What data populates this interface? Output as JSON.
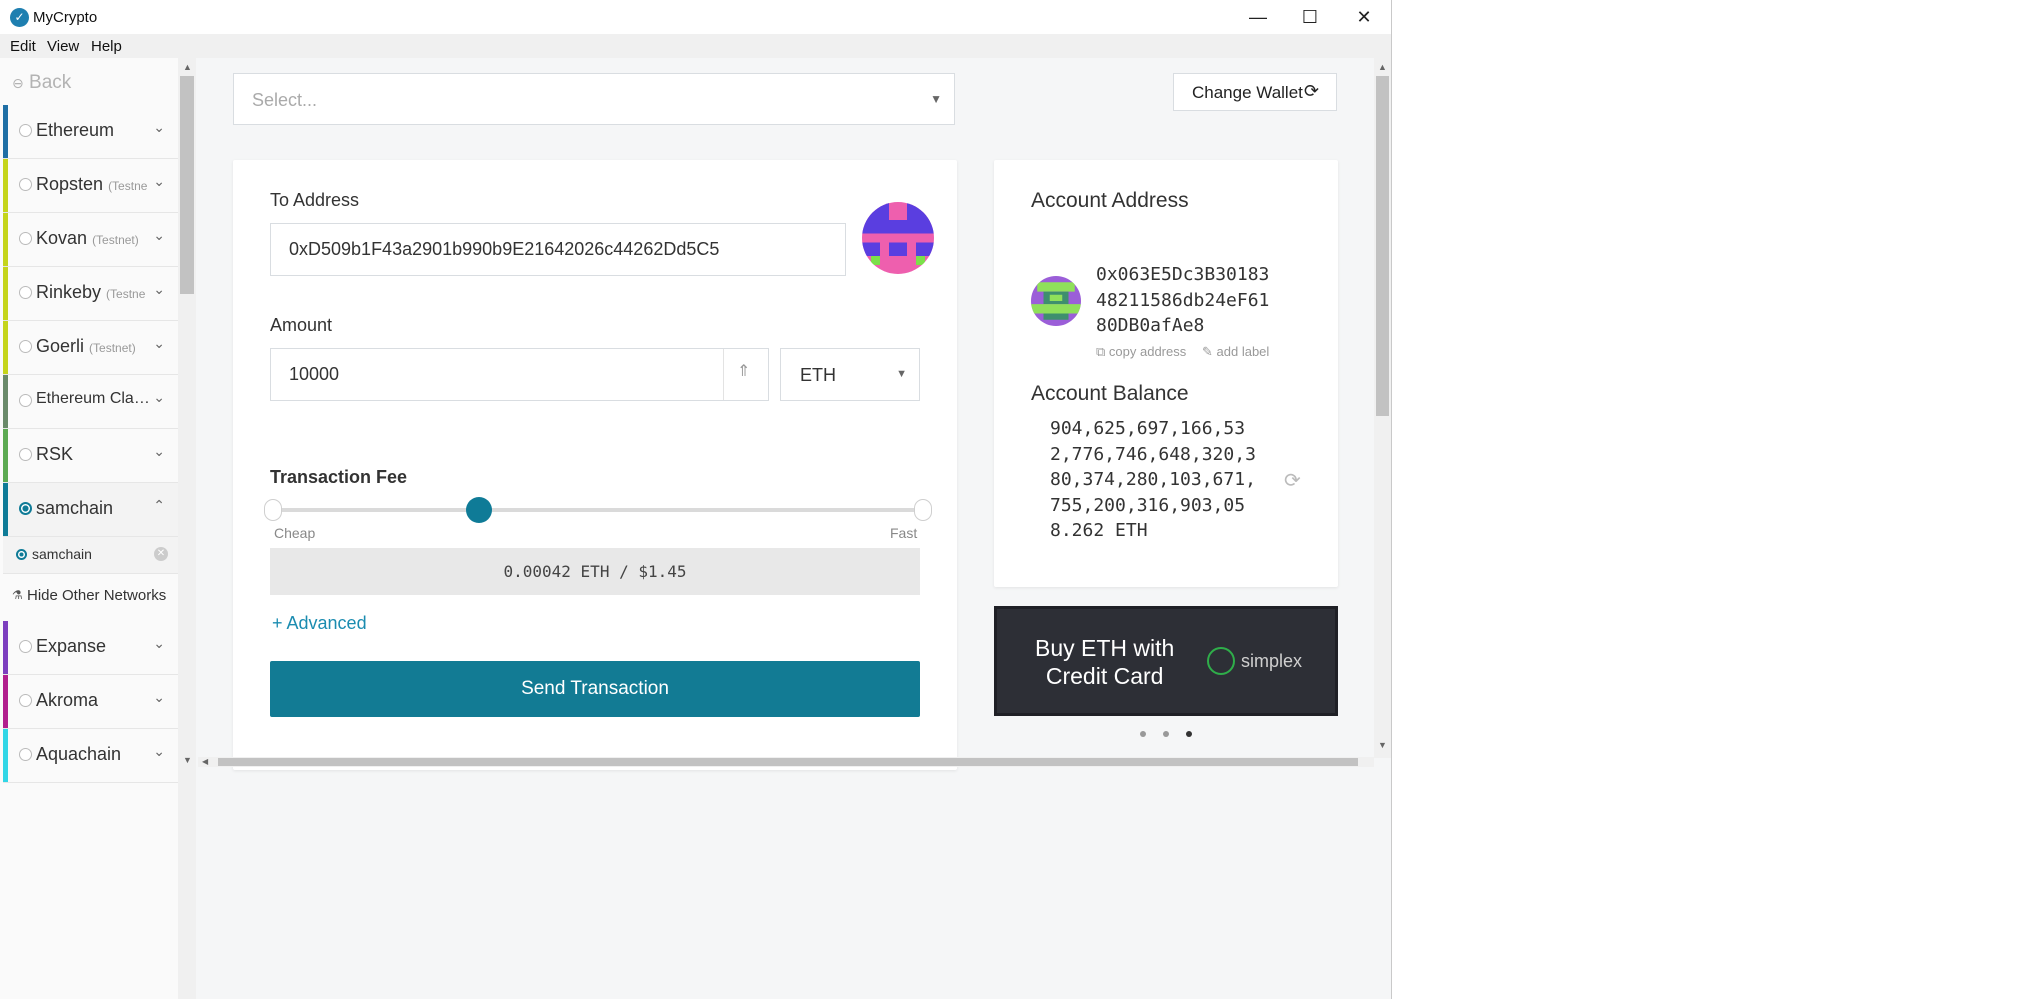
{
  "window": {
    "title": "MyCrypto",
    "minimize": "—",
    "maximize": "☐",
    "close": "✕"
  },
  "menu": [
    "Edit",
    "View",
    "Help"
  ],
  "sidebar": {
    "back_label": "Back",
    "networks": [
      {
        "name": "Ethereum",
        "testnet": "",
        "color": "#1f6fa5"
      },
      {
        "name": "Ropsten",
        "testnet": "(Testne",
        "color": "#c5d51b"
      },
      {
        "name": "Kovan",
        "testnet": "(Testnet)",
        "color": "#c5d51b"
      },
      {
        "name": "Rinkeby",
        "testnet": "(Testne",
        "color": "#c5d51b"
      },
      {
        "name": "Goerli",
        "testnet": "(Testnet)",
        "color": "#c5d51b"
      },
      {
        "name": "Ethereum Cla…",
        "testnet": "",
        "color": "#6a8a6a"
      },
      {
        "name": "RSK",
        "testnet": "",
        "color": "#5caa52"
      }
    ],
    "selected_network": {
      "name": "samchain",
      "color": "#0f7b97"
    },
    "sub_node": {
      "name": "samchain"
    },
    "hide_other": "Hide Other Networks",
    "other_networks": [
      {
        "name": "Expanse",
        "color": "#7d3fbf"
      },
      {
        "name": "Akroma",
        "color": "#b21f8e"
      },
      {
        "name": "Aquachain",
        "color": "#32d6e6"
      }
    ]
  },
  "wallet_select": {
    "placeholder": "Select..."
  },
  "change_wallet": {
    "label": "Change Wallet"
  },
  "send_form": {
    "to_label": "To Address",
    "to_value": "0xD509b1F43a2901b990b9E21642026c44262Dd5C5",
    "amount_label": "Amount",
    "amount_value": "10000",
    "unit": "ETH",
    "fee_label": "Transaction Fee",
    "cheap": "Cheap",
    "fast": "Fast",
    "fee_display": "0.00042 ETH / $1.45",
    "advanced": "+ Advanced",
    "send_button": "Send Transaction",
    "fee_level": 0.32
  },
  "account": {
    "address_title": "Account Address",
    "address_lines": [
      "0x063E5Dc3B30183",
      "48211586db24eF61",
      "80DB0afAe8"
    ],
    "copy_label": "copy address",
    "add_label": "add label",
    "balance_title": "Account Balance",
    "balance_lines": [
      "904,625,697,166,53",
      "2,776,746,648,320,3",
      "80,374,280,103,671,",
      "755,200,316,903,05",
      "8.262 ETH"
    ]
  },
  "promo": {
    "line1": "Buy ETH with",
    "line2": "Credit Card",
    "brand": "simplex"
  },
  "carousel": {
    "count": 3,
    "active": 3
  }
}
